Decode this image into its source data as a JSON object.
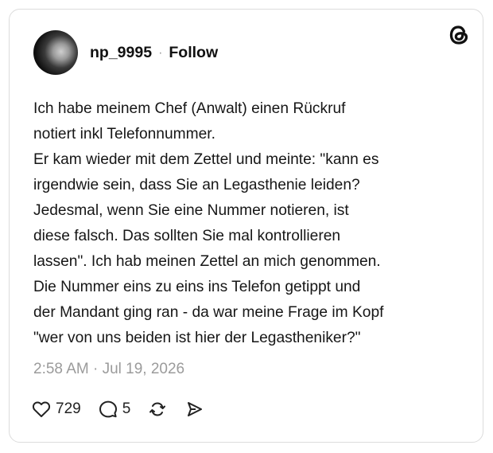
{
  "post": {
    "username": "np_9995",
    "separator": "·",
    "follow_label": "Follow",
    "body": "Ich habe meinem Chef (Anwalt) einen Rückruf\nnotiert inkl Telefonnummer.\nEr kam wieder mit dem Zettel und meinte: \"kann es\nirgendwie sein, dass Sie an Legasthenie leiden?\nJedesmal, wenn Sie eine Nummer notieren, ist\ndiese falsch. Das sollten Sie mal kontrollieren\nlassen\". Ich hab meinen Zettel an mich genommen.\nDie Nummer eins zu eins ins Telefon getippt und\nder Mandant ging ran - da war meine Frage im Kopf\n\"wer von uns beiden ist hier der Legastheniker?\"",
    "timestamp": "2:58 AM · Jul 19, 2026"
  },
  "actions": {
    "like_count": "729",
    "reply_count": "5"
  },
  "icons": {
    "logo": "threads-logo-icon",
    "like": "heart-icon",
    "reply": "comment-icon",
    "repost": "repost-icon",
    "share": "send-icon"
  }
}
